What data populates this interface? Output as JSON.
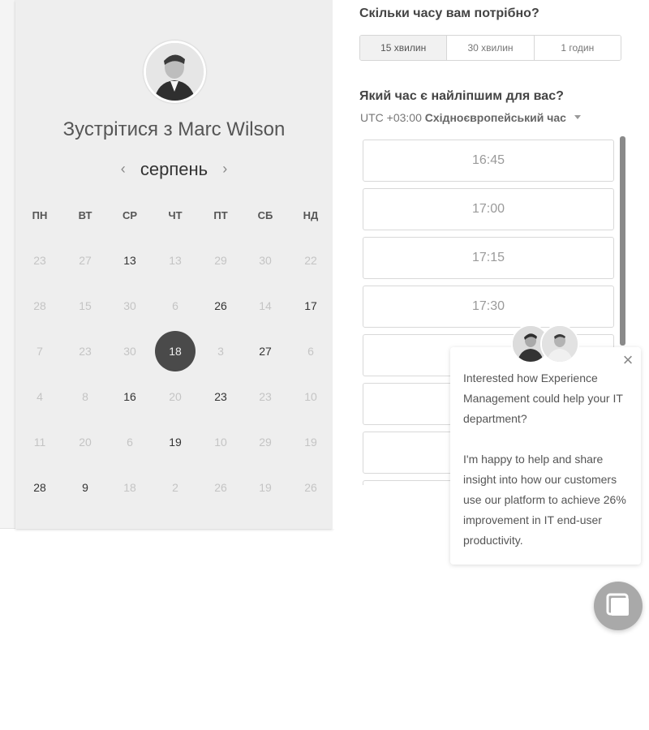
{
  "calendar": {
    "title": "Зустрітися з Marc Wilson",
    "month": "серпень",
    "prev_icon": "chevron-left-icon",
    "next_icon": "chevron-right-icon",
    "weekdays": [
      "ПН",
      "ВТ",
      "СР",
      "ЧТ",
      "ПТ",
      "СБ",
      "НД"
    ],
    "weeks": [
      [
        {
          "d": "23",
          "a": false
        },
        {
          "d": "27",
          "a": false
        },
        {
          "d": "13",
          "a": true
        },
        {
          "d": "13",
          "a": false
        },
        {
          "d": "29",
          "a": false
        },
        {
          "d": "30",
          "a": false
        },
        {
          "d": "22",
          "a": false
        }
      ],
      [
        {
          "d": "28",
          "a": false
        },
        {
          "d": "15",
          "a": false
        },
        {
          "d": "30",
          "a": false
        },
        {
          "d": "6",
          "a": false
        },
        {
          "d": "26",
          "a": true
        },
        {
          "d": "14",
          "a": false
        },
        {
          "d": "17",
          "a": true
        }
      ],
      [
        {
          "d": "7",
          "a": false
        },
        {
          "d": "23",
          "a": false
        },
        {
          "d": "30",
          "a": false
        },
        {
          "d": "18",
          "a": true,
          "selected": true
        },
        {
          "d": "3",
          "a": false
        },
        {
          "d": "27",
          "a": true
        },
        {
          "d": "6",
          "a": false
        }
      ],
      [
        {
          "d": "4",
          "a": false
        },
        {
          "d": "8",
          "a": false
        },
        {
          "d": "16",
          "a": true
        },
        {
          "d": "20",
          "a": false
        },
        {
          "d": "23",
          "a": true
        },
        {
          "d": "23",
          "a": false
        },
        {
          "d": "10",
          "a": false
        }
      ],
      [
        {
          "d": "11",
          "a": false
        },
        {
          "d": "20",
          "a": false
        },
        {
          "d": "6",
          "a": false
        },
        {
          "d": "19",
          "a": true
        },
        {
          "d": "10",
          "a": false
        },
        {
          "d": "29",
          "a": false
        },
        {
          "d": "19",
          "a": false
        }
      ],
      [
        {
          "d": "28",
          "a": true
        },
        {
          "d": "9",
          "a": true
        },
        {
          "d": "18",
          "a": false
        },
        {
          "d": "2",
          "a": false
        },
        {
          "d": "26",
          "a": false
        },
        {
          "d": "19",
          "a": false
        },
        {
          "d": "26",
          "a": false
        }
      ]
    ]
  },
  "duration": {
    "question": "Скільки часу вам потрібно?",
    "options": [
      "15 хвилин",
      "30 хвилин",
      "1 годин"
    ],
    "selected_index": 0
  },
  "time": {
    "question": "Який час є найліпшим для вас?",
    "tz_offset": "UTC +03:00",
    "tz_name": "Східноєвропейський час",
    "slots": [
      "16:45",
      "17:00",
      "17:15",
      "17:30",
      "",
      "",
      "",
      ""
    ]
  },
  "chat": {
    "message": "Interested how Experience Management could help your IT department?\n\nI'm happy to help and share insight into how our customers use our platform to achieve 26% improvement in IT end-user productivity.",
    "close_glyph": "×"
  },
  "colors": {
    "selected_day": "#4a4a4a",
    "card_bg": "#eeeeee",
    "scrollbar": "#8a8a8a"
  }
}
